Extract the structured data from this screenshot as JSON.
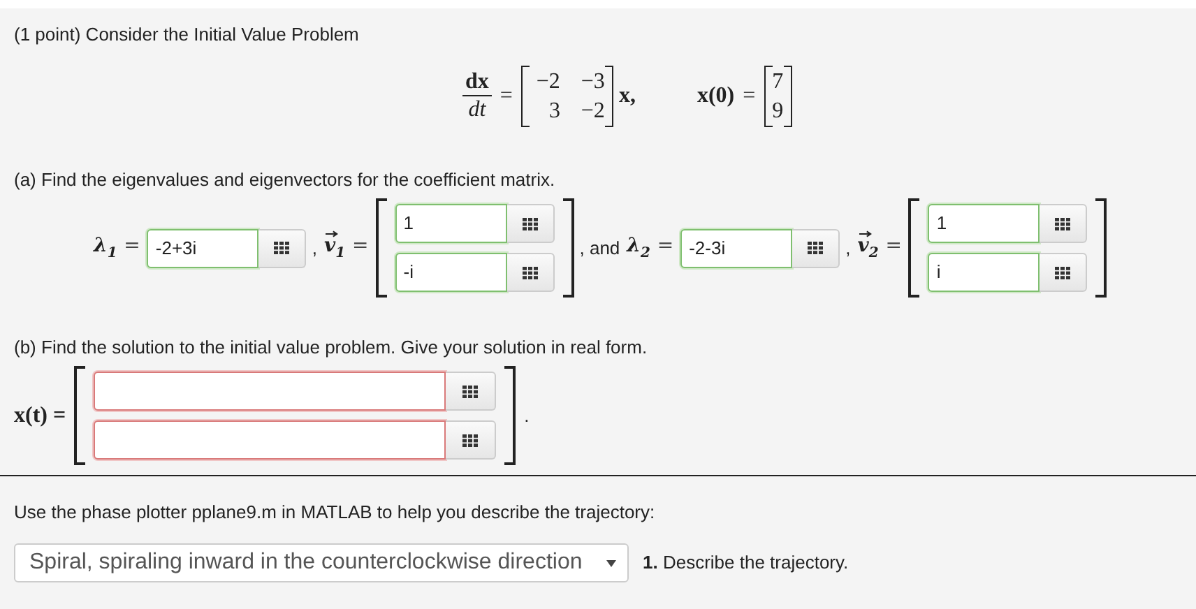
{
  "header": "(1 point) Consider the Initial Value Problem",
  "equation": {
    "numerator": "dx",
    "denominator": "dt",
    "equals": "=",
    "matrix": [
      [
        "−2",
        "−3"
      ],
      [
        "3",
        "−2"
      ]
    ],
    "vector_var": "x,",
    "ic_lhs": "x(0)",
    "ic_equals": "=",
    "ic": [
      "7",
      "9"
    ]
  },
  "part_a": {
    "prompt": "(a) Find the eigenvalues and eigenvectors for the coefficient matrix.",
    "items": [
      {
        "kind": "label",
        "symbol": "λ",
        "subscript": "1",
        "equals": "=",
        "vector": false
      },
      {
        "kind": "field",
        "value": "-2+3i",
        "correct": true
      },
      {
        "kind": "label",
        "prefix": ",",
        "symbol": "v",
        "subscript": "1",
        "equals": "=",
        "vector": true
      },
      {
        "kind": "vector",
        "fields": [
          {
            "value": "1",
            "correct": true
          },
          {
            "value": "-i",
            "correct": true
          }
        ]
      },
      {
        "kind": "label",
        "prefix": ", and",
        "symbol": "λ",
        "subscript": "2",
        "equals": "=",
        "vector": false
      },
      {
        "kind": "field",
        "value": "-2-3i",
        "correct": true
      },
      {
        "kind": "label",
        "prefix": ",",
        "symbol": "v",
        "subscript": "2",
        "equals": "=",
        "vector": true
      },
      {
        "kind": "vector",
        "fields": [
          {
            "value": "1",
            "correct": true
          },
          {
            "value": "i",
            "correct": true
          }
        ]
      }
    ]
  },
  "part_b": {
    "prompt": "(b) Find the solution to the initial value problem. Give your solution in real form.",
    "lhs": "x(t) =",
    "fields": [
      {
        "correct": false
      },
      {
        "correct": false
      }
    ],
    "end": "."
  },
  "part_c": {
    "prompt": "Use the phase plotter pplane9.m in MATLAB to help you describe the trajectory:",
    "select": {
      "value": "Spiral, spiraling inward in the counterclockwise direction"
    },
    "question": "**1.** Describe the trajectory."
  }
}
